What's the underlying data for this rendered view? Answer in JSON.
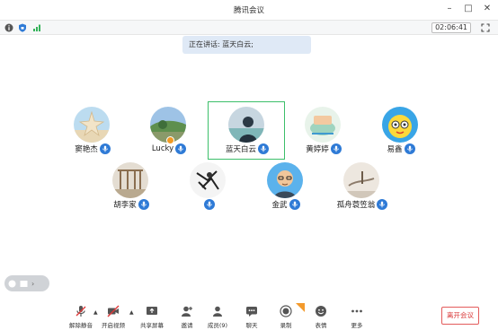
{
  "window": {
    "title": "腾讯会议"
  },
  "status": {
    "timer": "02:06:41"
  },
  "banner": {
    "speaking": "正在讲话: 蓝天白云;"
  },
  "participants": [
    {
      "name": "窦艳杰"
    },
    {
      "name": "Lucky"
    },
    {
      "name": "蓝天白云"
    },
    {
      "name": "黄婷婷"
    },
    {
      "name": "易鑫"
    },
    {
      "name": "胡李家"
    },
    {
      "name": ""
    },
    {
      "name": "金武"
    },
    {
      "name": "孤舟蓑笠翁"
    }
  ],
  "toolbar": {
    "unmute": "解除静音",
    "video": "开启视频",
    "share": "共享屏幕",
    "invite": "邀请",
    "members": "成员(9)",
    "chat": "聊天",
    "record": "录制",
    "reactions": "表情",
    "more": "更多",
    "leave": "离开会议"
  },
  "colors": {
    "accent": "#2e7ad6",
    "active_border": "#3cbf6a",
    "leave": "#d93838"
  }
}
